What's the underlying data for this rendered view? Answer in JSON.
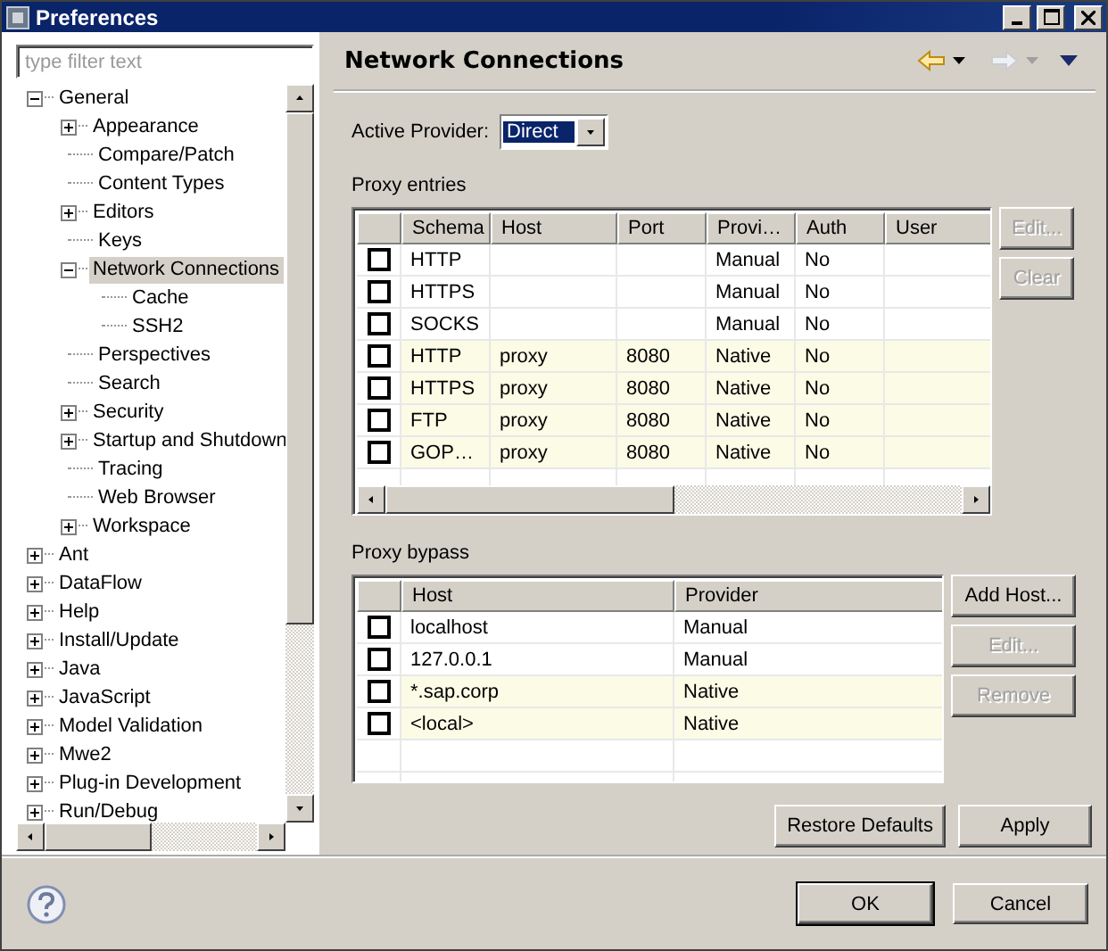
{
  "window": {
    "title": "Preferences"
  },
  "filter": {
    "placeholder": "type filter text"
  },
  "tree": [
    {
      "label": "General",
      "has_children": true,
      "expanded": true,
      "selected": false,
      "children": [
        {
          "label": "Appearance",
          "has_children": true,
          "expanded": false,
          "selected": false
        },
        {
          "label": "Compare/Patch",
          "has_children": false,
          "selected": false
        },
        {
          "label": "Content Types",
          "has_children": false,
          "selected": false
        },
        {
          "label": "Editors",
          "has_children": true,
          "expanded": false,
          "selected": false
        },
        {
          "label": "Keys",
          "has_children": false,
          "selected": false
        },
        {
          "label": "Network Connections",
          "has_children": true,
          "expanded": true,
          "selected": true,
          "children": [
            {
              "label": "Cache",
              "has_children": false,
              "selected": false
            },
            {
              "label": "SSH2",
              "has_children": false,
              "selected": false
            }
          ]
        },
        {
          "label": "Perspectives",
          "has_children": false,
          "selected": false
        },
        {
          "label": "Search",
          "has_children": false,
          "selected": false
        },
        {
          "label": "Security",
          "has_children": true,
          "expanded": false,
          "selected": false
        },
        {
          "label": "Startup and Shutdown",
          "has_children": true,
          "expanded": false,
          "selected": false
        },
        {
          "label": "Tracing",
          "has_children": false,
          "selected": false
        },
        {
          "label": "Web Browser",
          "has_children": false,
          "selected": false
        },
        {
          "label": "Workspace",
          "has_children": true,
          "expanded": false,
          "selected": false
        }
      ]
    },
    {
      "label": "Ant",
      "has_children": true,
      "expanded": false,
      "selected": false
    },
    {
      "label": "DataFlow",
      "has_children": true,
      "expanded": false,
      "selected": false
    },
    {
      "label": "Help",
      "has_children": true,
      "expanded": false,
      "selected": false
    },
    {
      "label": "Install/Update",
      "has_children": true,
      "expanded": false,
      "selected": false
    },
    {
      "label": "Java",
      "has_children": true,
      "expanded": false,
      "selected": false
    },
    {
      "label": "JavaScript",
      "has_children": true,
      "expanded": false,
      "selected": false
    },
    {
      "label": "Model Validation",
      "has_children": true,
      "expanded": false,
      "selected": false
    },
    {
      "label": "Mwe2",
      "has_children": true,
      "expanded": false,
      "selected": false
    },
    {
      "label": "Plug-in Development",
      "has_children": true,
      "expanded": false,
      "selected": false
    },
    {
      "label": "Run/Debug",
      "has_children": true,
      "expanded": false,
      "selected": false
    }
  ],
  "page": {
    "title": "Network Connections",
    "back_enabled": true,
    "forward_enabled": false
  },
  "active_provider": {
    "label": "Active Provider:",
    "value": "Direct"
  },
  "proxy_entries": {
    "label": "Proxy entries",
    "columns": [
      "Schema",
      "Host",
      "Port",
      "Provi…",
      "Auth",
      "User"
    ],
    "rows": [
      {
        "checked": false,
        "read_only": false,
        "cells": [
          "HTTP",
          "",
          "",
          "Manual",
          "No",
          ""
        ]
      },
      {
        "checked": false,
        "read_only": false,
        "cells": [
          "HTTPS",
          "",
          "",
          "Manual",
          "No",
          ""
        ]
      },
      {
        "checked": false,
        "read_only": false,
        "cells": [
          "SOCKS",
          "",
          "",
          "Manual",
          "No",
          ""
        ]
      },
      {
        "checked": false,
        "read_only": true,
        "cells": [
          "HTTP",
          "proxy",
          "8080",
          "Native",
          "No",
          ""
        ]
      },
      {
        "checked": false,
        "read_only": true,
        "cells": [
          "HTTPS",
          "proxy",
          "8080",
          "Native",
          "No",
          ""
        ]
      },
      {
        "checked": false,
        "read_only": true,
        "cells": [
          "FTP",
          "proxy",
          "8080",
          "Native",
          "No",
          ""
        ]
      },
      {
        "checked": false,
        "read_only": true,
        "cells": [
          "GOP…",
          "proxy",
          "8080",
          "Native",
          "No",
          ""
        ]
      }
    ],
    "buttons": [
      {
        "label": "Edit...",
        "disabled": true
      },
      {
        "label": "Clear",
        "disabled": true
      }
    ]
  },
  "proxy_bypass": {
    "label": "Proxy bypass",
    "columns": [
      "Host",
      "Provider"
    ],
    "rows": [
      {
        "checked": false,
        "read_only": false,
        "cells": [
          "localhost",
          "Manual"
        ]
      },
      {
        "checked": false,
        "read_only": false,
        "cells": [
          "127.0.0.1",
          "Manual"
        ]
      },
      {
        "checked": false,
        "read_only": true,
        "cells": [
          "*.sap.corp",
          "Native"
        ]
      },
      {
        "checked": false,
        "read_only": true,
        "cells": [
          "<local>",
          "Native"
        ]
      }
    ],
    "buttons": [
      {
        "label": "Add Host...",
        "disabled": false
      },
      {
        "label": "Edit...",
        "disabled": true
      },
      {
        "label": "Remove",
        "disabled": true
      }
    ]
  },
  "page_buttons": [
    "Restore Defaults",
    "Apply"
  ],
  "dialog_buttons": [
    {
      "label": "OK",
      "default": true
    },
    {
      "label": "Cancel",
      "default": false
    }
  ]
}
